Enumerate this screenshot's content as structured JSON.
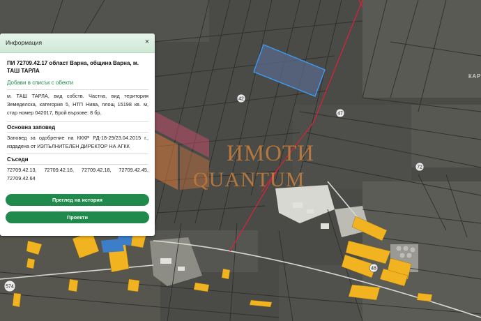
{
  "popup": {
    "title": "Информация",
    "close_symbol": "×",
    "plot_title": "ПИ 72709.42.17 област Варна, община Варна, м. ТАШ ТАРЛА",
    "add_link": "Добави в списък с обекти",
    "details": "м. ТАШ ТАРЛА, вид собств. Частна, вид територия Земеделска, категория 5, НТП Нива, площ 15198 кв. м, стар номер 042017, Брой вързове: 8 бр.",
    "order_heading": "Основна заповед",
    "order_text": "Заповед за одобрение на КККР РД-18-29/23.04.2015 г., издадена от ИЗПЪЛНИТЕЛЕН ДИРЕКТОР НА АГКК",
    "neighbors_heading": "Съседи",
    "neighbors": "72709.42.13, 72709.42.16, 72709.42.18, 72709.42.45, 72709.42.64",
    "history_button": "Преглед на история",
    "projects_button": "Проекти"
  },
  "map": {
    "labels": {
      "block_42": "42",
      "block_47": "47",
      "block_72": "72",
      "block_48": "48",
      "block_574": "574",
      "kar": "КАР"
    },
    "watermark": {
      "line1": "ИМОТИ",
      "line2": "QUANTUM"
    },
    "colors": {
      "selected_outline": "#3aa0ff",
      "boundary_red": "#c8283a",
      "building_yellow": "#f2b321",
      "building_blue": "#3d7ec9",
      "watermark_orange": "#d9803a",
      "button_green": "#1f8a4c"
    }
  }
}
